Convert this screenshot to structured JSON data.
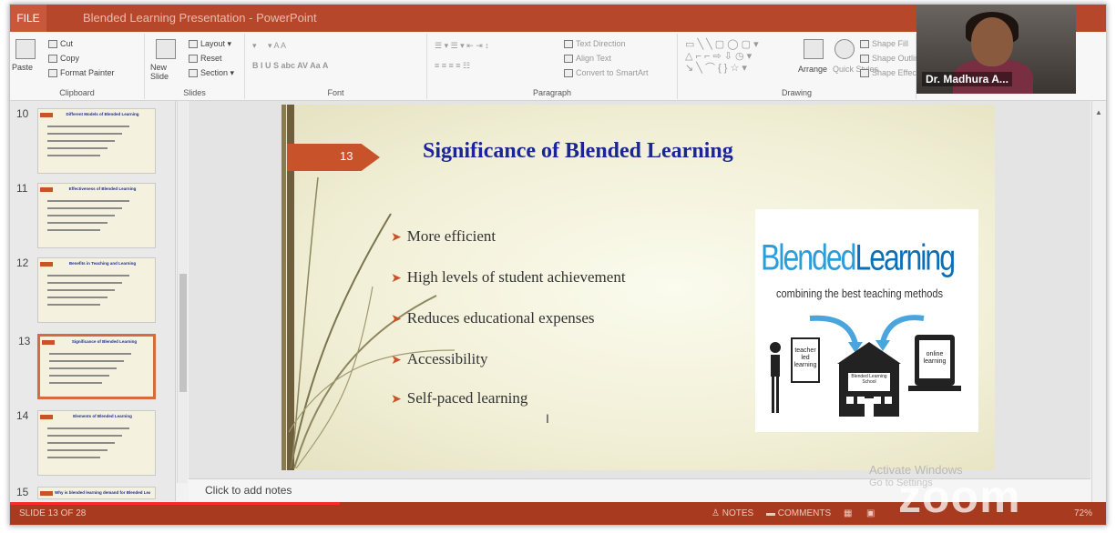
{
  "window": {
    "title": "Blended Learning Presentation - PowerPoint",
    "file_tab": "FILE"
  },
  "ribbon": {
    "clipboard": {
      "label": "Clipboard",
      "paste": "Paste",
      "cut": "Cut",
      "copy": "Copy",
      "format_painter": "Format Painter"
    },
    "slides": {
      "label": "Slides",
      "new_slide": "New Slide",
      "layout": "Layout",
      "reset": "Reset",
      "section": "Section"
    },
    "font": {
      "label": "Font"
    },
    "paragraph": {
      "label": "Paragraph",
      "text_direction": "Text Direction",
      "align_text": "Align Text",
      "convert_smartart": "Convert to SmartArt"
    },
    "drawing": {
      "label": "Drawing",
      "arrange": "Arrange",
      "quick_styles": "Quick Styles",
      "shape_fill": "Shape Fill",
      "shape_outline": "Shape Outline",
      "shape_effects": "Shape Effects"
    }
  },
  "video": {
    "name": "Dr. Madhura A..."
  },
  "thumbnails": [
    {
      "num": "10",
      "title": "Different Models of Blended Learning",
      "selected": false
    },
    {
      "num": "11",
      "title": "Effectiveness of Blended Learning",
      "selected": false
    },
    {
      "num": "12",
      "title": "Benefits in Teaching and Learning",
      "selected": false
    },
    {
      "num": "13",
      "title": "Significance of Blended Learning",
      "selected": true
    },
    {
      "num": "14",
      "title": "Elements of Blended Learning",
      "selected": false
    },
    {
      "num": "15",
      "title": "Why is blended learning demand for Blended Learning",
      "selected": false
    }
  ],
  "slide": {
    "number": "13",
    "title": "Significance of Blended Learning",
    "bullets": [
      "More efficient",
      "High levels of student achievement",
      "Reduces educational expenses",
      "Accessibility",
      "Self-paced learning"
    ],
    "image": {
      "word1": "Blended",
      "word2": "Learning",
      "tagline": "combining the best teaching methods",
      "teacher_label": "teacher led learning",
      "school_label": "Blended Learning School",
      "online_label": "online learning"
    }
  },
  "notes": {
    "placeholder": "Click to add notes"
  },
  "watermark": {
    "activate": "Activate Windows",
    "go_settings": "Go to Settings",
    "zoom": "zoom"
  },
  "status": {
    "slide_counter": "SLIDE 13 OF 28",
    "notes": "NOTES",
    "comments": "COMMENTS",
    "zoom_level": "72%"
  },
  "colors": {
    "accent": "#c8532b",
    "title_blue": "#1a2596",
    "statusbar": "#a83a20"
  },
  "video_progress": 0.3
}
